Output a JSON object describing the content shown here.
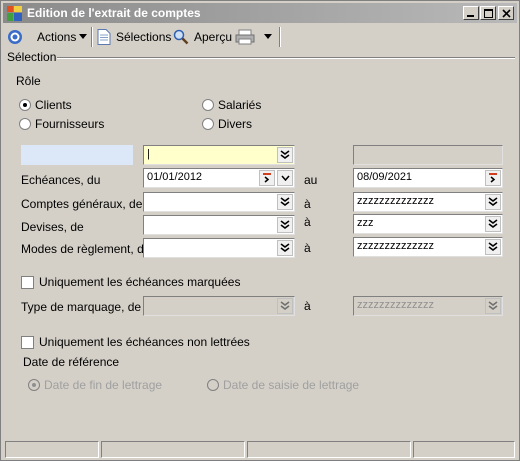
{
  "window": {
    "title": "Edition de l'extrait de comptes"
  },
  "toolbar": {
    "actions_label": "Actions",
    "selections_label": "Sélections",
    "apercu_label": "Aperçu"
  },
  "section": {
    "label": "Sélection"
  },
  "role": {
    "heading": "Rôle",
    "options": [
      "Clients",
      "Salariés",
      "Fournisseurs",
      "Divers"
    ],
    "selected": "Clients"
  },
  "form": {
    "top": {
      "left_value": "",
      "main_value": "|",
      "right_value": ""
    },
    "echeances": {
      "label": "Echéances, du",
      "from": "01/01/2012",
      "sep": "au",
      "to": "08/09/2021"
    },
    "comptes": {
      "label": "Comptes généraux, de",
      "from": "",
      "sep": "à",
      "to": "zzzzzzzzzzzzzz"
    },
    "devises": {
      "label": "Devises, de",
      "from": "",
      "sep": "à",
      "to": "zzz"
    },
    "modes": {
      "label": "Modes de règlement, de",
      "from": "",
      "sep": "à",
      "to": "zzzzzzzzzzzzzz"
    }
  },
  "marquees": {
    "label": "Uniquement les échéances marquées",
    "checked": false
  },
  "marquage": {
    "label": "Type de marquage, de",
    "from": "",
    "sep": "à",
    "to": "zzzzzzzzzzzzzz"
  },
  "non_lettrees": {
    "label": "Uniquement les échéances non lettrées",
    "checked": false
  },
  "date_ref": {
    "heading": "Date de référence",
    "options": [
      "Date de fin de lettrage",
      "Date de saisie de lettrage"
    ],
    "selected": "Date de fin de lettrage"
  },
  "icons": {
    "app": "app-icon",
    "actions": "target-icon",
    "selections": "document-icon",
    "apercu": "magnifier-icon",
    "print": "printer-icon"
  },
  "colors": {
    "title_gradient_start": "#8a8a8a",
    "field_highlight": "#ffffcc",
    "window_bg": "#d4d0c8"
  }
}
